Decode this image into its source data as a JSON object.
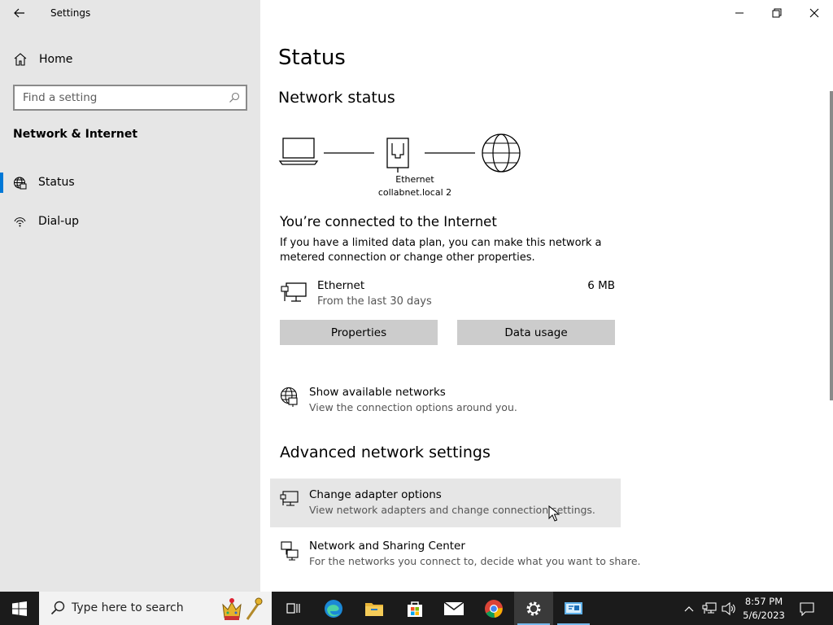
{
  "window": {
    "title": "Settings"
  },
  "sidebar": {
    "home_label": "Home",
    "search_placeholder": "Find a setting",
    "section_title": "Network & Internet",
    "items": [
      {
        "label": "Status",
        "icon": "globe-status-icon",
        "selected": true
      },
      {
        "label": "Dial-up",
        "icon": "dial-up-icon",
        "selected": false
      }
    ]
  },
  "main": {
    "page_title": "Status",
    "network_status_heading": "Network status",
    "diagram": {
      "adapter_label": "Ethernet",
      "network_label": "collabnet.local 2"
    },
    "connection_title": "You’re connected to the Internet",
    "connection_desc": "If you have a limited data plan, you can make this network a metered connection or change other properties.",
    "ethernet": {
      "name": "Ethernet",
      "subtitle": "From the last 30 days",
      "usage": "6 MB"
    },
    "buttons": {
      "properties": "Properties",
      "data_usage": "Data usage"
    },
    "show_networks": {
      "title": "Show available networks",
      "subtitle": "View the connection options around you."
    },
    "advanced_heading": "Advanced network settings",
    "change_adapter": {
      "title": "Change adapter options",
      "subtitle": "View network adapters and change connection settings."
    },
    "sharing_center": {
      "title": "Network and Sharing Center",
      "subtitle": "For the networks you connect to, decide what you want to share."
    }
  },
  "taskbar": {
    "search_placeholder": "Type here to search",
    "apps": [
      "task-view-icon",
      "edge-icon",
      "file-explorer-icon",
      "store-icon",
      "mail-icon",
      "chrome-icon",
      "settings-icon",
      "remote-desktop-icon"
    ],
    "clock_time": "8:57 PM",
    "clock_date": "5/6/2023"
  },
  "colors": {
    "accent": "#0078d7",
    "sidebar_bg": "#e6e6e6",
    "button_bg": "#cccccc",
    "taskbar_bg": "#1b1b1b"
  }
}
